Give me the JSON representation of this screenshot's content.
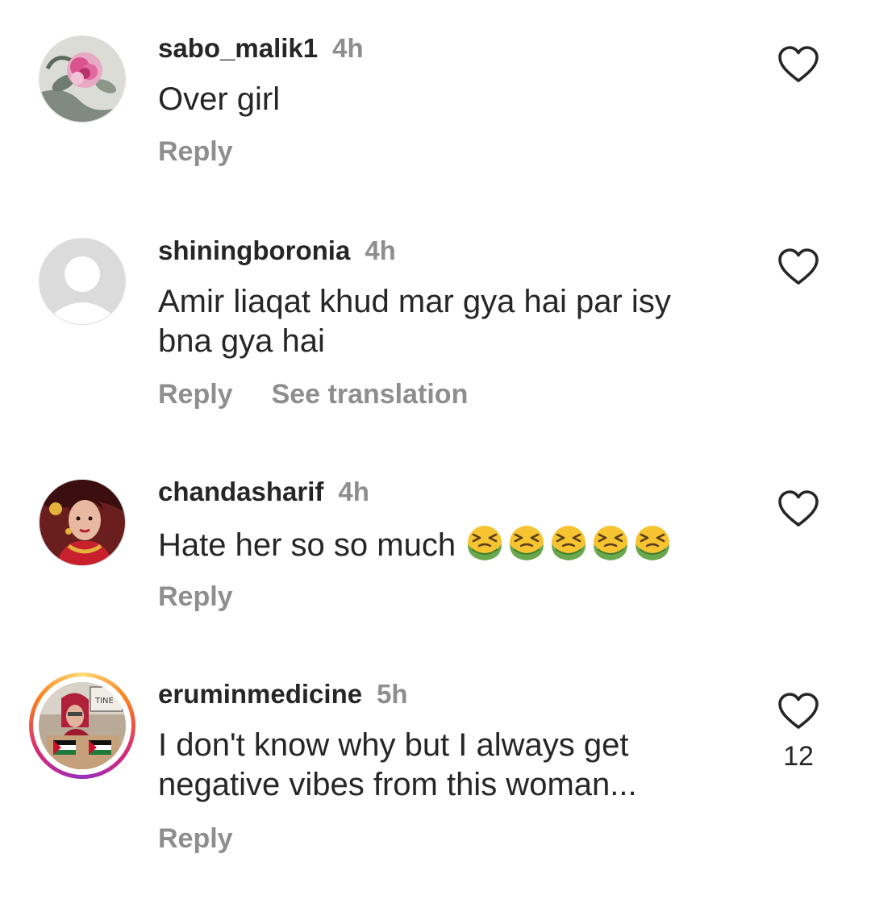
{
  "comments": [
    {
      "username": "sabo_malik1",
      "time": "4h",
      "text": "Over girl",
      "reply_label": "Reply",
      "avatar": "peony-flower-avatar"
    },
    {
      "username": "shiningboronia",
      "time": "4h",
      "text": "Amir liaqat khud mar gya hai par isy bna gya hai",
      "reply_label": "Reply",
      "translate_label": "See translation",
      "avatar": "default-avatar"
    },
    {
      "username": "chandasharif",
      "time": "4h",
      "text": "Hate her so so much",
      "emoji_icon": "nauseated-face-emoji",
      "emoji_count": 5,
      "reply_label": "Reply",
      "avatar": "bridal-portrait-avatar"
    },
    {
      "username": "eruminmedicine",
      "time": "5h",
      "text": "I don't know why but I always get negative vibes from this woman...",
      "reply_label": "Reply",
      "like_count": "12",
      "has_story": true,
      "avatar": "protest-photo-avatar"
    }
  ],
  "icons": {
    "like": "heart-outline-icon"
  },
  "colors": {
    "text": "#262626",
    "secondary": "#8e8e8e",
    "story_ring": [
      "#feda75",
      "#fa7e1e",
      "#d62976",
      "#962fbf"
    ]
  }
}
